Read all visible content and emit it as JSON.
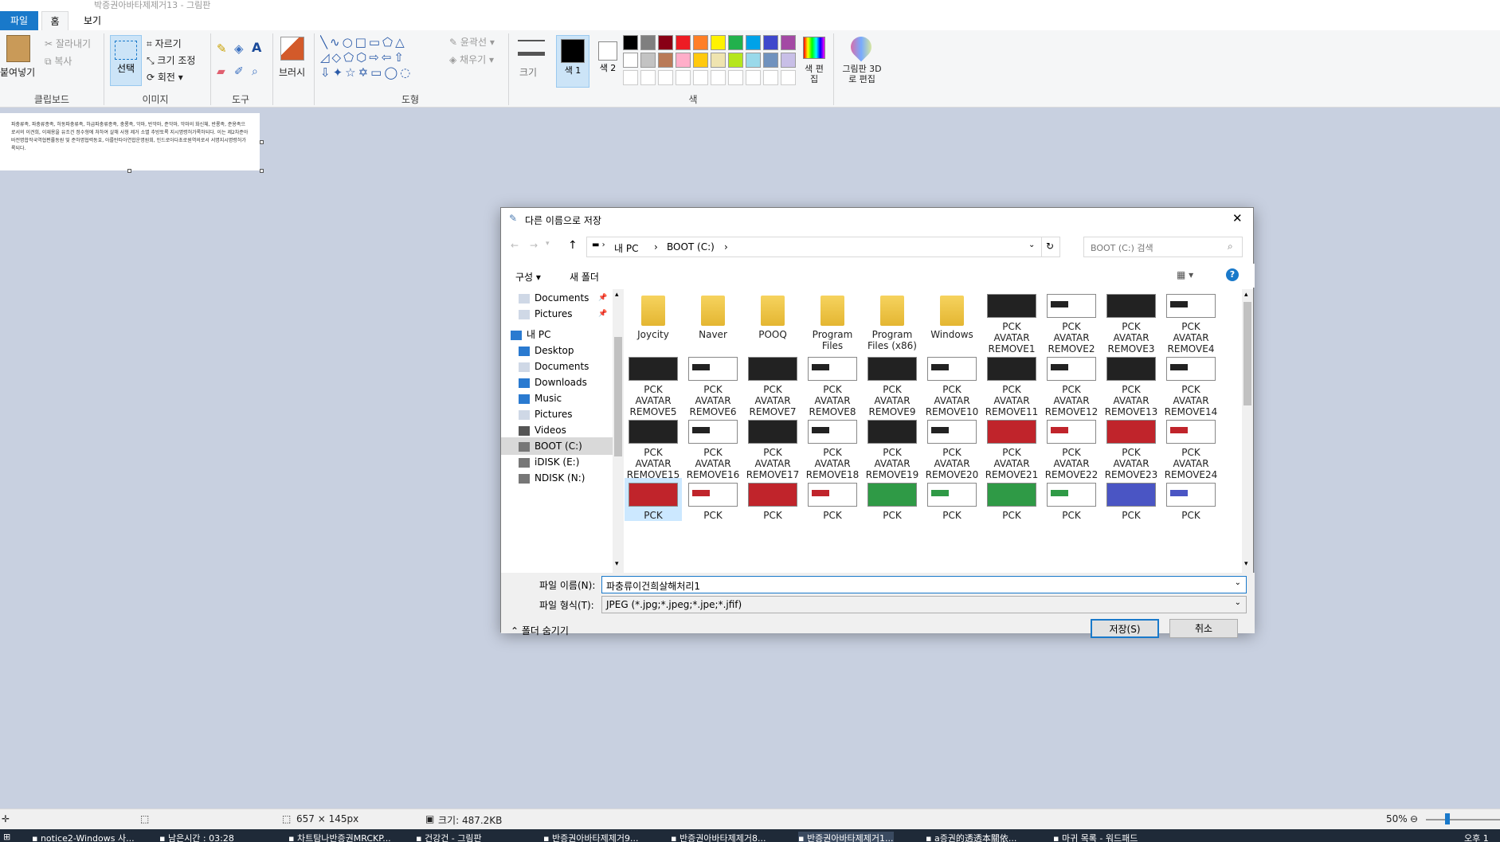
{
  "window": {
    "title": "박증권아바타제제거13 - 그림판"
  },
  "ribbon": {
    "tabs": [
      "파일",
      "홈",
      "보기"
    ],
    "paste": "붙여넣기",
    "cut": "잘라내기",
    "copy": "복사",
    "select": "선택",
    "crop": "자르기",
    "resize": "크기 조정",
    "rotate": "회전",
    "brushes": "브러시",
    "outline": "윤곽선",
    "fill": "채우기",
    "size": "크기",
    "color1": "색 1",
    "color2": "색 2",
    "edit_colors": "색 편집",
    "paint3d": "그림판 3D로 편집",
    "groups": {
      "clipboard": "클립보드",
      "image": "이미지",
      "tools": "도구",
      "shapes": "도형",
      "colors": "색"
    },
    "palette_row1": [
      "#000000",
      "#7f7f7f",
      "#880015",
      "#ed1c24",
      "#ff7f27",
      "#fff200",
      "#22b14c",
      "#00a2e8",
      "#3f48cc",
      "#a349a4"
    ],
    "palette_row2": [
      "#ffffff",
      "#c3c3c3",
      "#b97a57",
      "#ffaec9",
      "#ffc90e",
      "#efe4b0",
      "#b5e61d",
      "#99d9ea",
      "#7092be",
      "#c8bfe7"
    ]
  },
  "canvas": {
    "text": "파충류족, 파충류종족, 허동파충류족, 하급파충류종족, 충룡족, 악마, 반악마, 준악마, 악마의 화신체, 반룡족, 준용족으로서의 이견희, 이재용을 유조건 정수형에 처하여 살해 사형 제거 소멸 추방토록 지시명령허가록하되다. 이는 제2차준아바전명합작국역협편률동원 및 준하명협력동호, 아를탄타아연합운명원회, 인드로아다초로원역의로서 서명지시명령허가록되다."
  },
  "dialog": {
    "title": "다른 이름으로 저장",
    "close": "✕",
    "breadcrumb": [
      "내 PC",
      "BOOT (C:)"
    ],
    "search_placeholder": "BOOT (C:) 검색",
    "organize": "구성",
    "new_folder": "새 폴더",
    "help": "?",
    "nav_items": [
      {
        "label": "Documents",
        "pinned": true
      },
      {
        "label": "Pictures",
        "pinned": true
      },
      {
        "label": "내 PC"
      },
      {
        "label": "Desktop"
      },
      {
        "label": "Documents"
      },
      {
        "label": "Downloads"
      },
      {
        "label": "Music"
      },
      {
        "label": "Pictures"
      },
      {
        "label": "Videos"
      },
      {
        "label": "BOOT (C:)",
        "selected": true
      },
      {
        "label": "iDISK (E:)"
      },
      {
        "label": "NDISK (N:)"
      }
    ],
    "files": [
      {
        "name": "Joycity",
        "kind": "folder"
      },
      {
        "name": "Naver",
        "kind": "folder"
      },
      {
        "name": "POOQ",
        "kind": "folder"
      },
      {
        "name": "Program Files",
        "kind": "folder"
      },
      {
        "name": "Program Files (x86)",
        "kind": "folder"
      },
      {
        "name": "Windows",
        "kind": "folder"
      },
      {
        "name": "PCK AVATAR REMOVE1",
        "kind": "dark"
      },
      {
        "name": "PCK AVATAR REMOVE2",
        "kind": "light"
      },
      {
        "name": "PCK AVATAR REMOVE3",
        "kind": "dark"
      },
      {
        "name": "PCK AVATAR REMOVE4",
        "kind": "light"
      },
      {
        "name": "PCK AVATAR REMOVE5",
        "kind": "dark"
      },
      {
        "name": "PCK AVATAR REMOVE6",
        "kind": "light"
      },
      {
        "name": "PCK AVATAR REMOVE7",
        "kind": "dark"
      },
      {
        "name": "PCK AVATAR REMOVE8",
        "kind": "light"
      },
      {
        "name": "PCK AVATAR REMOVE9",
        "kind": "dark"
      },
      {
        "name": "PCK AVATAR REMOVE10",
        "kind": "light"
      },
      {
        "name": "PCK AVATAR REMOVE11",
        "kind": "dark"
      },
      {
        "name": "PCK AVATAR REMOVE12",
        "kind": "light"
      },
      {
        "name": "PCK AVATAR REMOVE13",
        "kind": "dark"
      },
      {
        "name": "PCK AVATAR REMOVE14",
        "kind": "light"
      },
      {
        "name": "PCK AVATAR REMOVE15",
        "kind": "dark"
      },
      {
        "name": "PCK AVATAR REMOVE16",
        "kind": "light"
      },
      {
        "name": "PCK AVATAR REMOVE17",
        "kind": "dark"
      },
      {
        "name": "PCK AVATAR REMOVE18",
        "kind": "light"
      },
      {
        "name": "PCK AVATAR REMOVE19",
        "kind": "dark"
      },
      {
        "name": "PCK AVATAR REMOVE20",
        "kind": "light"
      },
      {
        "name": "PCK AVATAR REMOVE21",
        "kind": "red"
      },
      {
        "name": "PCK AVATAR REMOVE22",
        "kind": "lightred"
      },
      {
        "name": "PCK AVATAR REMOVE23",
        "kind": "red"
      },
      {
        "name": "PCK AVATAR REMOVE24",
        "kind": "lightred"
      },
      {
        "name": "PCK",
        "kind": "red"
      },
      {
        "name": "PCK",
        "kind": "lightred"
      },
      {
        "name": "PCK",
        "kind": "red"
      },
      {
        "name": "PCK",
        "kind": "lightred"
      },
      {
        "name": "PCK",
        "kind": "green"
      },
      {
        "name": "PCK",
        "kind": "lightgreen"
      },
      {
        "name": "PCK",
        "kind": "green"
      },
      {
        "name": "PCK",
        "kind": "lightgreen"
      },
      {
        "name": "PCK",
        "kind": "blue"
      },
      {
        "name": "PCK",
        "kind": "lightblue"
      }
    ],
    "filename_label": "파일 이름(N):",
    "filename_value": "파충류이건희살해처리1",
    "filetype_label": "파일 형식(T):",
    "filetype_value": "JPEG (*.jpg;*.jpeg;*.jpe;*.jfif)",
    "hide_folders": "폴더 숨기기",
    "save": "저장(S)",
    "cancel": "취소"
  },
  "status": {
    "dimensions": "657 × 145px",
    "size": "크기: 487.2KB",
    "zoom": "50%"
  },
  "taskbar": {
    "items": [
      "notice2-Windows 사...",
      "남은시간 : 03:28",
      "차트탐나반증권MRCKP...",
      "건강건 - 그림판",
      "반증권아바타제제거9...",
      "반증권아바타제제거8...",
      "반증권아바타제제거1...",
      "a증권的透透本關依...",
      "마귀 목록 - 워드패드"
    ],
    "clock": "오후 1"
  }
}
